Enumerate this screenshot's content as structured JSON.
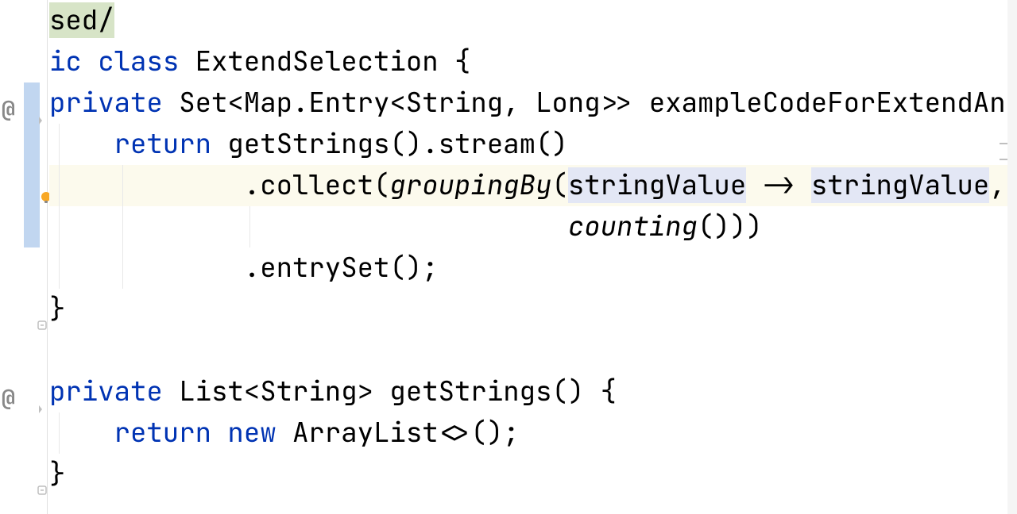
{
  "code": {
    "line1": {
      "selected": "sed/"
    },
    "line2": {
      "kw1": "ic",
      "kw2": "class",
      "classname": "ExtendSelection",
      "brace": " {"
    },
    "line3": {
      "kw": "private",
      "type_pre": " Set<Map.Entry<String, Long>> ",
      "method": "exampleCodeForExtendAndS"
    },
    "line4": {
      "indent": "    ",
      "kw": "return",
      "call": " getStrings().stream()"
    },
    "line5": {
      "indent": "            ",
      "pre": ".collect(",
      "grouping": "groupingBy",
      "paren": "(",
      "var1": "stringValue",
      "arrow": " -> ",
      "var2": "stringValue",
      "comma": ","
    },
    "line6": {
      "indent": "                                ",
      "counting": "counting",
      "suffix": "()))"
    },
    "line7": {
      "indent": "            ",
      "call": ".entrySet();"
    },
    "line8": {
      "brace": "}"
    },
    "line9": {
      "blank": ""
    },
    "line10": {
      "kw": "private",
      "type": " List<String> ",
      "method": "getStrings",
      "suffix": "() {"
    },
    "line11": {
      "indent": "    ",
      "kw1": "return",
      "sp": " ",
      "kw2": "new",
      "call": " ArrayList<>();"
    },
    "line12": {
      "brace": "}"
    }
  },
  "icons": {
    "annotation": "@",
    "bulb": "bulb"
  }
}
